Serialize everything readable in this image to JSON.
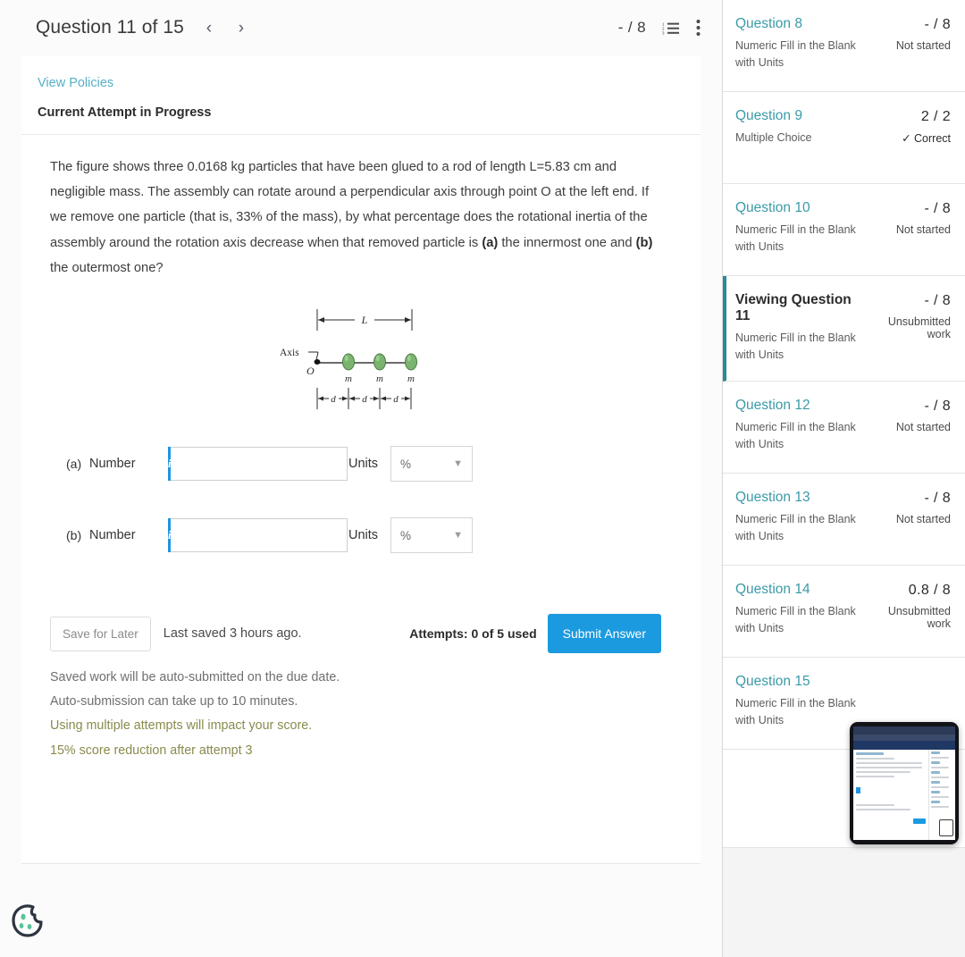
{
  "header": {
    "title": "Question 11 of 15",
    "prev_icon": "chevron-left-icon",
    "next_icon": "chevron-right-icon",
    "score": "- / 8",
    "list_icon": "numbered-list-icon",
    "menu_icon": "kebab-menu-icon"
  },
  "card": {
    "policies_link": "View Policies",
    "attempt_status": "Current Attempt in Progress",
    "question_text_1": "The figure shows three 0.0168 kg particles that have been glued to a rod of length L=5.83 cm and negligible mass. The assembly can rotate around a perpendicular axis through point O at the left end. If we remove one particle (that is, 33% of the mass), by what percentage does the rotational inertia of the assembly around the rotation axis decrease when that removed particle is ",
    "bold_a": "(a)",
    "question_text_2": " the innermost one and ",
    "bold_b": "(b)",
    "question_text_3": " the outermost one?"
  },
  "figure": {
    "label_L": "L",
    "label_axis": "Axis",
    "label_O": "O",
    "label_mass": "m",
    "label_d": "d",
    "particle_color": "#7ab56f",
    "particle_count": 3
  },
  "answers": [
    {
      "part": "(a)",
      "number_label": "Number",
      "info_glyph": "i",
      "value": "",
      "placeholder": "",
      "units_label": "Units",
      "units_value": "%"
    },
    {
      "part": "(b)",
      "number_label": "Number",
      "info_glyph": "i",
      "value": "",
      "placeholder": "",
      "units_label": "Units",
      "units_value": "%"
    }
  ],
  "footer": {
    "save_label": "Save for Later",
    "last_saved": "Last saved 3 hours ago.",
    "attempts": "Attempts: 0 of 5 used",
    "submit_label": "Submit Answer",
    "note": "Saved work will be auto-submitted on the due date. Auto-submission can take up to 10 minutes.",
    "warn1": "Using multiple attempts will impact your score.",
    "warn2": "15% score reduction after attempt 3"
  },
  "cookie_icon": "cookie-consent-icon",
  "sidebar": {
    "items": [
      {
        "title": "Question 8",
        "type": "Numeric Fill in the Blank with Units",
        "score": "- / 8",
        "status": "Not started",
        "active": false,
        "correct": false
      },
      {
        "title": "Question 9",
        "type": "Multiple Choice",
        "score": "2 / 2",
        "status": "✓ Correct",
        "active": false,
        "correct": true
      },
      {
        "title": "Question 10",
        "type": "Numeric Fill in the Blank with Units",
        "score": "- / 8",
        "status": "Not started",
        "active": false,
        "correct": false
      },
      {
        "title": "Viewing Question 11",
        "type": "Numeric Fill in the Blank with Units",
        "score": "- / 8",
        "status": "Unsubmitted work",
        "active": true,
        "correct": false
      },
      {
        "title": "Question 12",
        "type": "Numeric Fill in the Blank with Units",
        "score": "- / 8",
        "status": "Not started",
        "active": false,
        "correct": false
      },
      {
        "title": "Question 13",
        "type": "Numeric Fill in the Blank with Units",
        "score": "- / 8",
        "status": "Not started",
        "active": false,
        "correct": false
      },
      {
        "title": "Question 14",
        "type": "Numeric Fill in the Blank with Units",
        "score": "0.8 / 8",
        "status": "Unsubmitted work",
        "active": false,
        "correct": false
      },
      {
        "title": "Question 15",
        "type": "Numeric Fill in the Blank with Units",
        "score": "",
        "status": "",
        "active": false,
        "correct": false
      }
    ]
  },
  "pip": {
    "name": "picture-in-picture-preview"
  },
  "colors": {
    "accent_blue": "#1b9ae0",
    "link_teal": "#3a9aa8",
    "policy_link": "#55b0c6",
    "active_border": "#2a8a95",
    "warn_olive": "#8a8a4e"
  }
}
